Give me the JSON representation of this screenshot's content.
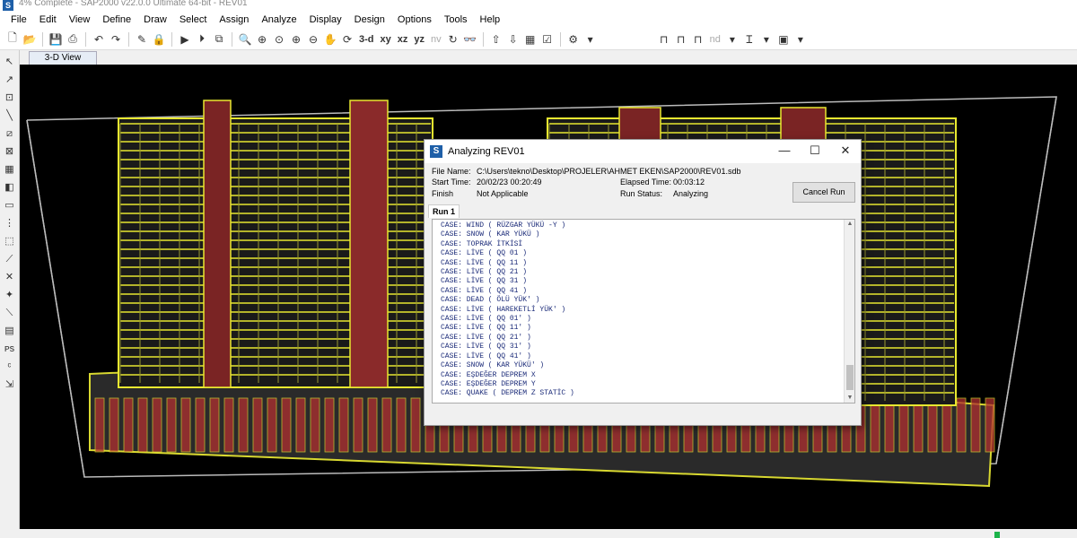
{
  "window": {
    "title": "4% Complete - SAP2000 v22.0.0 Ultimate 64-bit - REV01",
    "icon": "sap2000-icon"
  },
  "menu": [
    "File",
    "Edit",
    "View",
    "Define",
    "Draw",
    "Select",
    "Assign",
    "Analyze",
    "Display",
    "Design",
    "Options",
    "Tools",
    "Help"
  ],
  "toolbar": {
    "view_3d": "3-d",
    "view_xy": "xy",
    "view_xz": "xz",
    "view_yz": "yz",
    "view_nv": "nv",
    "nd": "nd"
  },
  "tabs": {
    "view_tab": "3-D View"
  },
  "dialog": {
    "title": "Analyzing REV01",
    "file_name_label": "File Name:",
    "file_name": "C:\\Users\\tekno\\Desktop\\PROJELER\\AHMET EKEN\\SAP2000\\REV01.sdb",
    "start_time_label": "Start Time:",
    "start_time": "20/02/23 00:20:49",
    "elapsed_label": "Elapsed Time:",
    "elapsed": "00:03:12",
    "finish_label": "Finish",
    "finish": "Not Applicable",
    "run_status_label": "Run Status:",
    "run_status": "Analyzing",
    "cancel_button": "Cancel Run",
    "run_tab": "Run 1",
    "log_lines": [
      "CASE: WIND ( RÜZGAR YÜKÜ -Y )",
      "CASE: SNOW ( KAR YÜKÜ )",
      "CASE: TOPRAK İTKİSİ",
      "CASE: LİVE ( QQ 01 )",
      "CASE: LİVE ( QQ 11 )",
      "CASE: LİVE ( QQ 21 )",
      "CASE: LİVE ( QQ 31 )",
      "CASE: LİVE ( QQ 41 )",
      "CASE: DEAD ( ÖLÜ YÜK' )",
      "CASE: LİVE ( HAREKETLİ YÜK' )",
      "CASE: LİVE ( QQ 01' )",
      "CASE: LİVE ( QQ 11' )",
      "CASE: LİVE ( QQ 21' )",
      "CASE: LİVE ( QQ 31' )",
      "CASE: LİVE ( QQ 41' )",
      "CASE: SNOW ( KAR YÜKÜ' )",
      "CASE: EŞDEĞER DEPREM X",
      "CASE: EŞDEĞER DEPREM Y",
      "CASE: QUAKE ( DEPREM Z STATİC )"
    ]
  },
  "colors": {
    "frame_yellow": "#e8e830",
    "wall_red": "#b03030",
    "background": "#000000",
    "accent_blue": "#1e5fa8"
  }
}
